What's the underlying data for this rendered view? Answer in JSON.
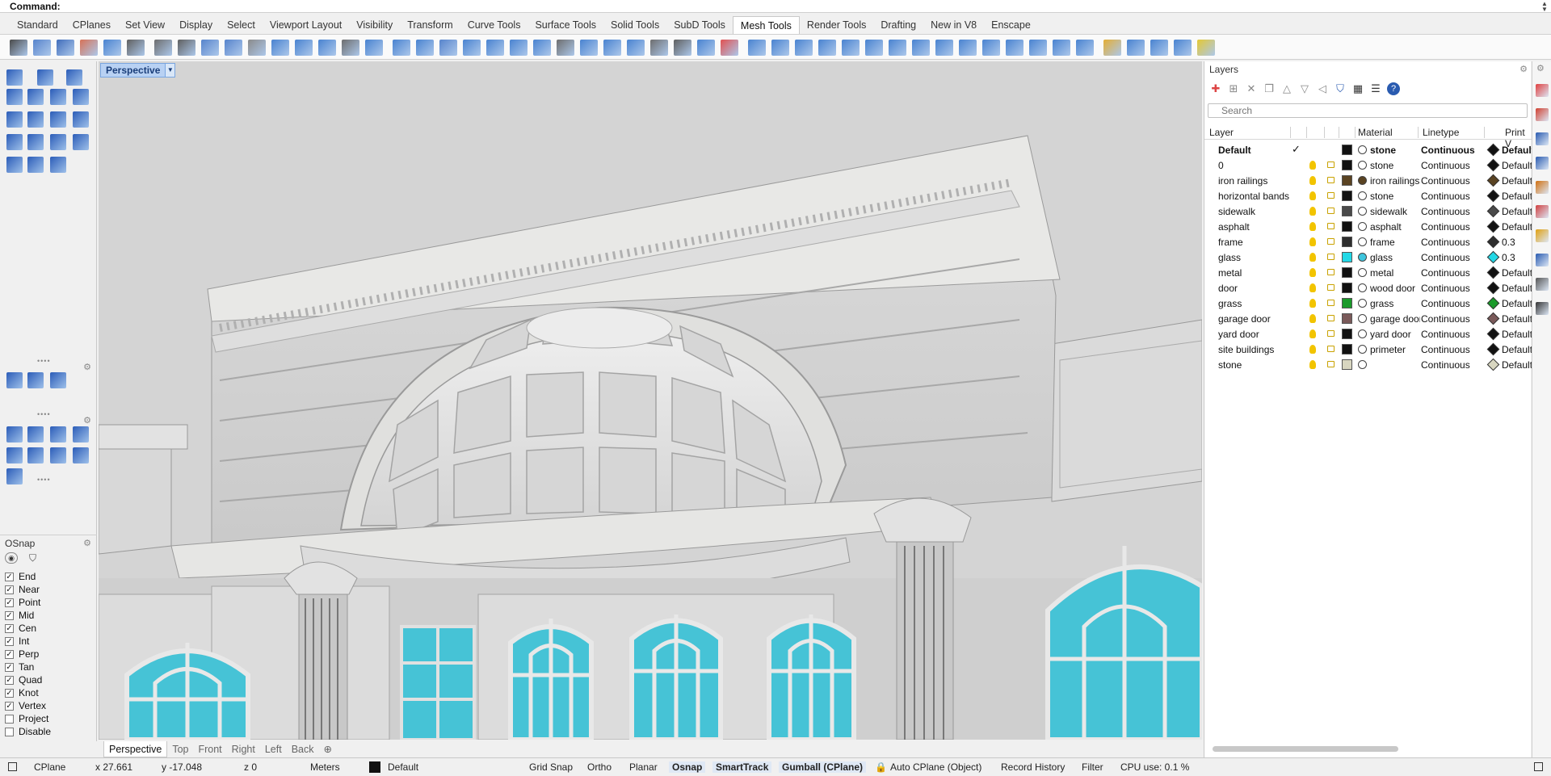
{
  "command": {
    "label": "Command:"
  },
  "tabs": [
    "Standard",
    "CPlanes",
    "Set View",
    "Display",
    "Select",
    "Viewport Layout",
    "Visibility",
    "Transform",
    "Curve Tools",
    "Surface Tools",
    "Solid Tools",
    "SubD Tools",
    "Mesh Tools",
    "Render Tools",
    "Drafting",
    "New in V8",
    "Enscape"
  ],
  "active_tab": "Mesh Tools",
  "viewport": {
    "title": "Perspective"
  },
  "viewport_tabs": [
    "Perspective",
    "Top",
    "Front",
    "Right",
    "Left",
    "Back"
  ],
  "osnap": {
    "title": "OSnap",
    "items": [
      {
        "label": "End",
        "checked": true
      },
      {
        "label": "Near",
        "checked": true
      },
      {
        "label": "Point",
        "checked": true
      },
      {
        "label": "Mid",
        "checked": true
      },
      {
        "label": "Cen",
        "checked": true
      },
      {
        "label": "Int",
        "checked": true
      },
      {
        "label": "Perp",
        "checked": true
      },
      {
        "label": "Tan",
        "checked": true
      },
      {
        "label": "Quad",
        "checked": true
      },
      {
        "label": "Knot",
        "checked": true
      },
      {
        "label": "Vertex",
        "checked": true
      },
      {
        "label": "Project",
        "checked": false
      },
      {
        "label": "Disable",
        "checked": false
      }
    ]
  },
  "layers": {
    "title": "Layers",
    "search_placeholder": "Search",
    "headers": {
      "layer": "Layer",
      "material": "Material",
      "linetype": "Linetype",
      "print": "Print V"
    },
    "rows": [
      {
        "name": "Default",
        "current": true,
        "color": "#111111",
        "mat": "stone",
        "mat_color": "#ffffff",
        "lt": "Continuous",
        "pc": "#111111",
        "pw": "Default"
      },
      {
        "name": "0",
        "current": false,
        "color": "#111111",
        "mat": "stone",
        "mat_color": "#ffffff",
        "lt": "Continuous",
        "pc": "#111111",
        "pw": "Default"
      },
      {
        "name": "iron railings",
        "current": false,
        "color": "#5a4322",
        "mat": "iron railings",
        "mat_color": "#5a4322",
        "lt": "Continuous",
        "pc": "#5a4322",
        "pw": "Default"
      },
      {
        "name": "horizontal bands",
        "current": false,
        "color": "#111111",
        "mat": "stone",
        "mat_color": "#ffffff",
        "lt": "Continuous",
        "pc": "#111111",
        "pw": "Default"
      },
      {
        "name": "sidewalk",
        "current": false,
        "color": "#4a4a4a",
        "mat": "sidewalk",
        "mat_color": "#ffffff",
        "lt": "Continuous",
        "pc": "#4a4a4a",
        "pw": "Default"
      },
      {
        "name": "asphalt",
        "current": false,
        "color": "#111111",
        "mat": "asphalt",
        "mat_color": "#ffffff",
        "lt": "Continuous",
        "pc": "#111111",
        "pw": "Default"
      },
      {
        "name": "frame",
        "current": false,
        "color": "#2e2e2e",
        "mat": "frame",
        "mat_color": "#ffffff",
        "lt": "Continuous",
        "pc": "#2e2e2e",
        "pw": "0.3"
      },
      {
        "name": "glass",
        "current": false,
        "color": "#22d8e6",
        "mat": "glass",
        "mat_color": "#3ec5dd",
        "lt": "Continuous",
        "pc": "#22d8e6",
        "pw": "0.3"
      },
      {
        "name": "metal",
        "current": false,
        "color": "#111111",
        "mat": "metal",
        "mat_color": "#ffffff",
        "lt": "Continuous",
        "pc": "#111111",
        "pw": "Default"
      },
      {
        "name": "door",
        "current": false,
        "color": "#111111",
        "mat": "wood door",
        "mat_color": "#ffffff",
        "lt": "Continuous",
        "pc": "#111111",
        "pw": "Default"
      },
      {
        "name": "grass",
        "current": false,
        "color": "#1a9a2a",
        "mat": "grass",
        "mat_color": "#ffffff",
        "lt": "Continuous",
        "pc": "#1a9a2a",
        "pw": "Default"
      },
      {
        "name": "garage door",
        "current": false,
        "color": "#7a5a5a",
        "mat": "garage door",
        "mat_color": "#ffffff",
        "lt": "Continuous",
        "pc": "#7a5a5a",
        "pw": "Default"
      },
      {
        "name": "yard door",
        "current": false,
        "color": "#111111",
        "mat": "yard door",
        "mat_color": "#ffffff",
        "lt": "Continuous",
        "pc": "#111111",
        "pw": "Default"
      },
      {
        "name": "site buildings",
        "current": false,
        "color": "#111111",
        "mat": "primeter",
        "mat_color": "#ffffff",
        "lt": "Continuous",
        "pc": "#111111",
        "pw": "Default"
      },
      {
        "name": "stone",
        "current": false,
        "color": "#d8d6c0",
        "mat": "",
        "mat_color": "#ffffff",
        "lt": "Continuous",
        "pc": "#d8d6c0",
        "pw": "Default"
      }
    ]
  },
  "status": {
    "cplane": "CPlane",
    "x": "x 27.661",
    "y": "y -17.048",
    "z": "z 0",
    "units": "Meters",
    "layer": "Default",
    "grid_snap": "Grid Snap",
    "ortho": "Ortho",
    "planar": "Planar",
    "osnap": "Osnap",
    "smarttrack": "SmartTrack",
    "gumball": "Gumball (CPlane)",
    "auto_cplane": "Auto CPlane (Object)",
    "record_history": "Record History",
    "filter": "Filter",
    "cpu": "CPU use: 0.1 %"
  },
  "colors": {
    "accent": "#1a3e7a",
    "glass": "#46c3d6",
    "stone": "#e4e4e2"
  }
}
